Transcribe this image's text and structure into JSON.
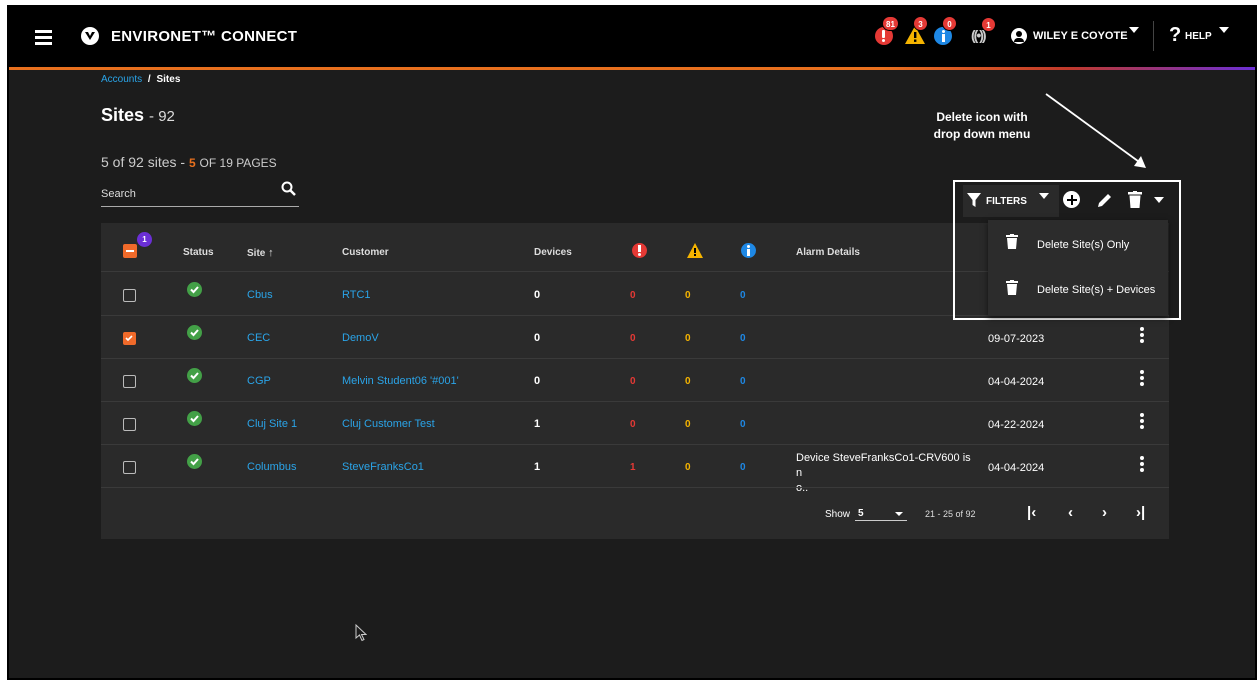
{
  "app": {
    "title": "ENVIRONET™ CONNECT"
  },
  "header": {
    "alerts": {
      "critical": "81",
      "warning": "3",
      "info": "0",
      "wireless": "1"
    },
    "user_name": "WILEY E COYOTE",
    "help_label": "HELP"
  },
  "breadcrumb": {
    "root": "Accounts",
    "sep": "/",
    "current": "Sites"
  },
  "page": {
    "title": "Sites",
    "count_suffix": "- 92"
  },
  "pagination_summary": {
    "shown": "5 of 92 sites -",
    "current_page": "5",
    "pages_text": "OF 19 PAGES"
  },
  "search": {
    "label": "Search"
  },
  "toolbar": {
    "filters_label": "FILTERS"
  },
  "annotation": {
    "line1": "Delete icon with",
    "line2": "drop down menu"
  },
  "delete_menu": {
    "item1": "Delete Site(s) Only",
    "item2": "Delete Site(s) + Devices"
  },
  "table": {
    "selected_count": "1",
    "headers": {
      "status": "Status",
      "site": "Site",
      "customer": "Customer",
      "devices": "Devices",
      "alarm_details": "Alarm Details"
    },
    "rows": [
      {
        "site": "Cbus",
        "customer": "RTC1",
        "devices": "0",
        "critical": "0",
        "warning": "0",
        "info": "0",
        "alarm": "",
        "date": "",
        "checked": false
      },
      {
        "site": "CEC",
        "customer": "DemoV",
        "devices": "0",
        "critical": "0",
        "warning": "0",
        "info": "0",
        "alarm": "",
        "date": "09-07-2023",
        "checked": true
      },
      {
        "site": "CGP",
        "customer": "Melvin Student06 '#001'",
        "devices": "0",
        "critical": "0",
        "warning": "0",
        "info": "0",
        "alarm": "",
        "date": "04-04-2024",
        "checked": false
      },
      {
        "site": "Cluj Site 1",
        "customer": "Cluj Customer Test",
        "devices": "1",
        "critical": "0",
        "warning": "0",
        "info": "0",
        "alarm": "",
        "date": "04-22-2024",
        "checked": false
      },
      {
        "site": "Columbus",
        "customer": "SteveFranksCo1",
        "devices": "1",
        "critical": "1",
        "warning": "0",
        "info": "0",
        "alarm": "Device SteveFranksCo1-CRV600 is n",
        "alarm2": "o..",
        "date": "04-04-2024",
        "checked": false
      }
    ]
  },
  "footer": {
    "show_label": "Show",
    "page_size": "5",
    "range": "21 - 25 of 92"
  },
  "colors": {
    "accent": "#e8701e",
    "link": "#2aa4e8",
    "critical": "#e53935",
    "warning": "#f5b400",
    "info": "#1e88e5",
    "ok": "#43a047",
    "selected": "#f06a2a"
  }
}
